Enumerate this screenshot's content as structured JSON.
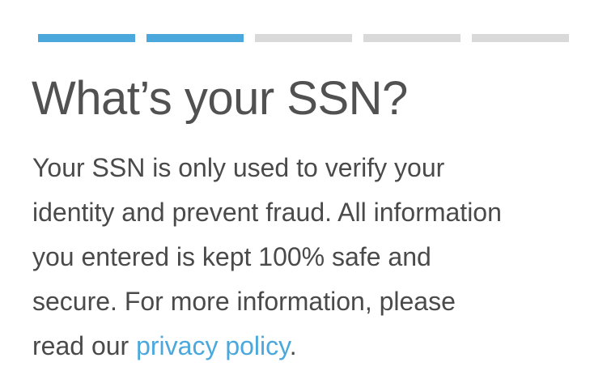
{
  "progress": {
    "total_steps": 5,
    "completed_steps": 2,
    "colors": {
      "completed": "#4aa8dc",
      "remaining": "#d9d9d9"
    }
  },
  "heading": {
    "title": "What’s your SSN?"
  },
  "body": {
    "lines": [
      "Your SSN is only used to verify your",
      "identity and prevent fraud. All information",
      "you entered is kept 100% safe and",
      "secure. For more information, please"
    ],
    "last_line_prefix": "read our ",
    "link_text": "privacy policy",
    "last_line_suffix": "."
  },
  "colors": {
    "link": "#4aa8dc",
    "text": "#4a4a4a",
    "title": "#515151"
  }
}
